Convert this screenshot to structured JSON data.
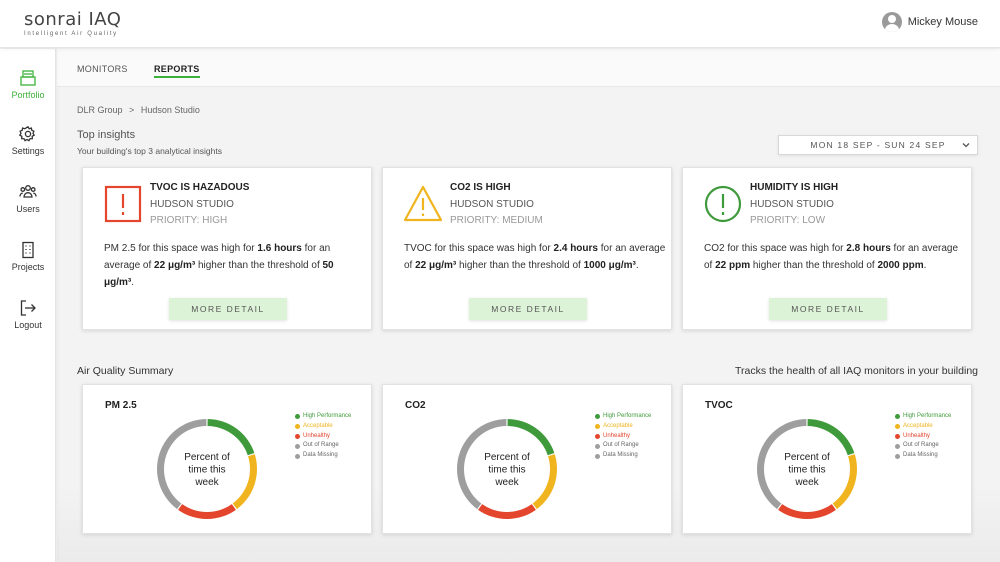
{
  "header": {
    "logo_main": "sonrai IAQ",
    "logo_sub": "Intelligent Air Quality",
    "user_name": "Mickey Mouse"
  },
  "sidebar": {
    "items": [
      {
        "label": "Portfolio",
        "icon": "portfolio-icon",
        "active": true
      },
      {
        "label": "Settings",
        "icon": "gear-icon",
        "active": false
      },
      {
        "label": "Users",
        "icon": "users-icon",
        "active": false
      },
      {
        "label": "Projects",
        "icon": "building-icon",
        "active": false
      },
      {
        "label": "Logout",
        "icon": "logout-icon",
        "active": false
      }
    ]
  },
  "tabs": [
    {
      "label": "MONITORS",
      "active": false
    },
    {
      "label": "REPORTS",
      "active": true
    }
  ],
  "breadcrumb": {
    "parent": "DLR Group",
    "separator": ">",
    "current": "Hudson Studio"
  },
  "insights_section": {
    "title": "Top insights",
    "subtitle": "Your building's top 3 analytical insights",
    "date_range": "MON 18 SEP - SUN 24 SEP"
  },
  "insights": [
    {
      "title": "TVOC IS HAZADOUS",
      "location": "HUDSON STUDIO",
      "priority": "PRIORITY: HIGH",
      "icon": "alert-square-icon",
      "color": "#e3452d",
      "text_1": "PM 2.5 for this space was high for ",
      "value_1": "1.6 hours",
      "text_2": " for an average of ",
      "value_2": "22 μg/m³",
      "text_3": " higher than the threshold of ",
      "value_3": "50 μg/m³",
      "text_4": ".",
      "button": "MORE DETAIL"
    },
    {
      "title": "CO2 IS HIGH",
      "location": "HUDSON STUDIO",
      "priority": "PRIORITY: MEDIUM",
      "icon": "alert-triangle-icon",
      "color": "#f0b41e",
      "text_1": "TVOC for this space was high for ",
      "value_1": "2.4 hours",
      "text_2": " for an average of ",
      "value_2": "22 μg/m³",
      "text_3": " higher than the threshold of ",
      "value_3": "1000 μg/m³",
      "text_4": ".",
      "button": "MORE DETAIL"
    },
    {
      "title": "HUMIDITY IS HIGH",
      "location": "HUDSON STUDIO",
      "priority": "PRIORITY: LOW",
      "icon": "alert-circle-icon",
      "color": "#3f9a3c",
      "text_1": "CO2 for this space was high for ",
      "value_1": "2.8 hours",
      "text_2": " for an average of ",
      "value_2": "22 ppm",
      "text_3": " higher than the threshold of ",
      "value_3": "2000 ppm",
      "text_4": ".",
      "button": "MORE DETAIL"
    }
  ],
  "summary_section": {
    "title": "Air Quality Summary",
    "right_text": "Tracks the health of all IAQ monitors in your building"
  },
  "chart_data": [
    {
      "type": "pie",
      "title": "PM 2.5",
      "center_label": "Percent of time this week",
      "categories": [
        "High Performance",
        "Acceptable",
        "Unhealthy",
        "Out of Range",
        "Data Missing"
      ],
      "values": [
        20,
        20,
        20,
        0,
        40
      ],
      "colors": [
        "#3f9a3c",
        "#f0b41e",
        "#e3452d",
        "#9e9e9e",
        "#9e9e9e"
      ],
      "legend_colors": [
        "#3f9a3c",
        "#f0b41e",
        "#e3452d",
        "#9e9e9e",
        "#9e9e9e"
      ]
    },
    {
      "type": "pie",
      "title": "CO2",
      "center_label": "Percent of time this week",
      "categories": [
        "High Performance",
        "Acceptable",
        "Unhealthy",
        "Out of Range",
        "Data Missing"
      ],
      "values": [
        20,
        20,
        20,
        0,
        40
      ],
      "colors": [
        "#3f9a3c",
        "#f0b41e",
        "#e3452d",
        "#9e9e9e",
        "#9e9e9e"
      ],
      "legend_colors": [
        "#3f9a3c",
        "#f0b41e",
        "#e3452d",
        "#9e9e9e",
        "#9e9e9e"
      ]
    },
    {
      "type": "pie",
      "title": "TVOC",
      "center_label": "Percent of time this week",
      "categories": [
        "High Performance",
        "Acceptable",
        "Unhealthy",
        "Out of Range",
        "Data Missing"
      ],
      "values": [
        20,
        20,
        20,
        0,
        40
      ],
      "colors": [
        "#3f9a3c",
        "#f0b41e",
        "#e3452d",
        "#9e9e9e",
        "#9e9e9e"
      ],
      "legend_colors": [
        "#3f9a3c",
        "#f0b41e",
        "#e3452d",
        "#9e9e9e",
        "#9e9e9e"
      ]
    }
  ],
  "colors": {
    "accent": "#3db23a",
    "button_bg": "#ddf3d8"
  }
}
